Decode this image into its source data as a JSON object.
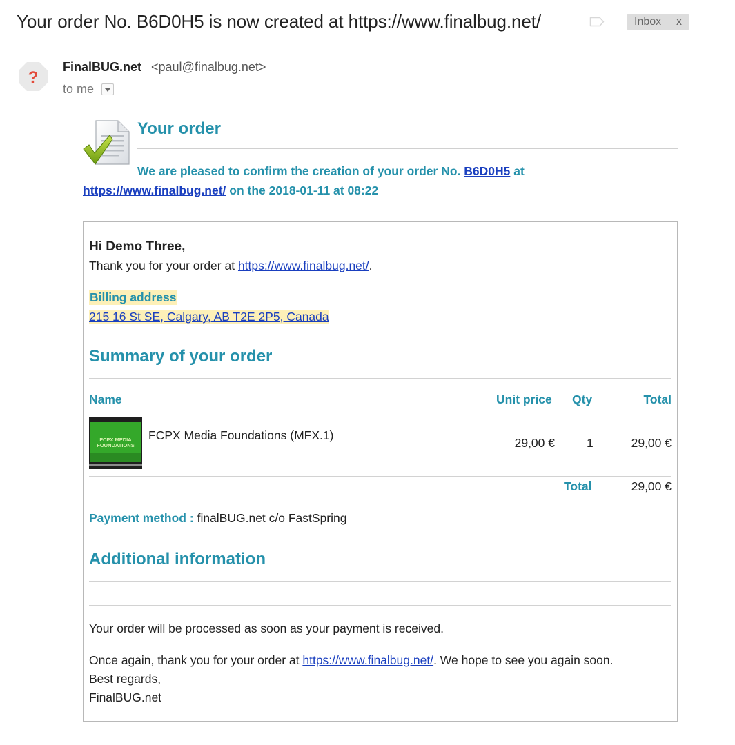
{
  "subject": {
    "title": "Your order No. B6D0H5 is now created at https://www.finalbug.net/",
    "label": "Inbox",
    "label_remove": "x"
  },
  "sender": {
    "avatar_glyph": "?",
    "name": "FinalBUG.net",
    "email": "<paul@finalbug.net>",
    "recipient": "to me"
  },
  "email": {
    "heading": "Your order",
    "confirm_prefix": "We are pleased to confirm the creation of your order No.",
    "order_number": "B6D0H5",
    "confirm_at": "at",
    "site_url": "https://www.finalbug.net/",
    "confirm_on": "on the 2018-01-11 at 08:22",
    "greeting": "Hi Demo Three,",
    "thanks_prefix": "Thank you for your order at",
    "thanks_suffix": ".",
    "billing_title": "Billing address",
    "billing_address": "215 16 St SE, Calgary, AB T2E 2P5, Canada",
    "summary_title": "Summary of your order",
    "table": {
      "headers": {
        "name": "Name",
        "unit_price": "Unit price",
        "qty": "Qty",
        "total": "Total"
      },
      "rows": [
        {
          "thumb_text_1": "FCPX MEDIA",
          "thumb_text_2": "FOUNDATIONS",
          "name": "FCPX Media Foundations (MFX.1)",
          "unit_price": "29,00 €",
          "qty": "1",
          "total": "29,00 €"
        }
      ],
      "total_label": "Total",
      "total_value": "29,00 €"
    },
    "payment_label": "Payment method :",
    "payment_value": "finalBUG.net c/o FastSpring",
    "additional_title": "Additional information",
    "processing_note": "Your order will be processed as soon as your payment is received.",
    "again_prefix": "Once again, thank you for your order at",
    "again_suffix": ". We hope to see you again soon.",
    "regards": "Best regards,",
    "signature": "FinalBUG.net"
  },
  "colors": {
    "accent": "#2591ab",
    "link": "#1a3fbf",
    "highlight": "#fdf0b8",
    "chip_bg": "#dddddd"
  },
  "icons": {
    "avatar": "question-mark-icon",
    "tag": "label-tag-icon",
    "header": "document-checkmark-icon",
    "dropdown": "chevron-down-icon"
  }
}
